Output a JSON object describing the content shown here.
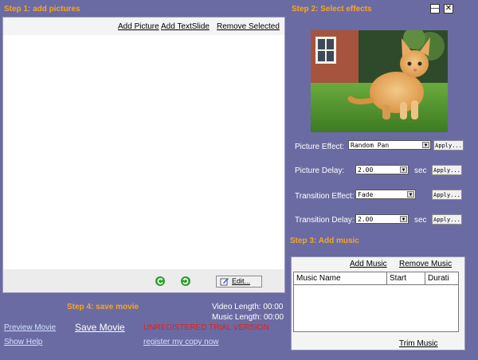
{
  "step1": {
    "title": "Step 1: add pictures",
    "add_picture": "Add Picture",
    "add_textslide": "Add TextSlide",
    "remove_selected": "Remove Selected",
    "edit_label": "Edit..."
  },
  "step2": {
    "title": "Step 2: Select effects",
    "picture_effect_label": "Picture Effect:",
    "picture_effect_value": "Random Pan",
    "picture_delay_label": "Picture Delay:",
    "picture_delay_value": "2.00",
    "transition_effect_label": "Transition Effect:",
    "transition_effect_value": "Fade",
    "transition_delay_label": "Transition Delay:",
    "transition_delay_value": "2.00",
    "sec_label": "sec",
    "apply_label": "Apply..."
  },
  "step3": {
    "title": "Step 3: Add music",
    "add_music": "Add Music",
    "remove_music": "Remove Music",
    "columns": [
      "Music Name",
      "Start",
      "Durati"
    ],
    "trim_music": "Trim Music"
  },
  "step4": {
    "title": "Step 4: save movie",
    "video_length": "Video Length: 00:00",
    "music_length": "Music Length: 00:00",
    "preview_movie": "Preview Movie",
    "save_movie": "Save Movie",
    "show_help": "Show Help",
    "unregistered": "UNREGISTERED TRIAL VERSION",
    "register": "register my copy now"
  },
  "window": {
    "minimize": "—",
    "close": "✕"
  },
  "colors": {
    "background": "#6b6ba3",
    "step_title": "#f5a623",
    "unregistered": "#e0201a"
  }
}
